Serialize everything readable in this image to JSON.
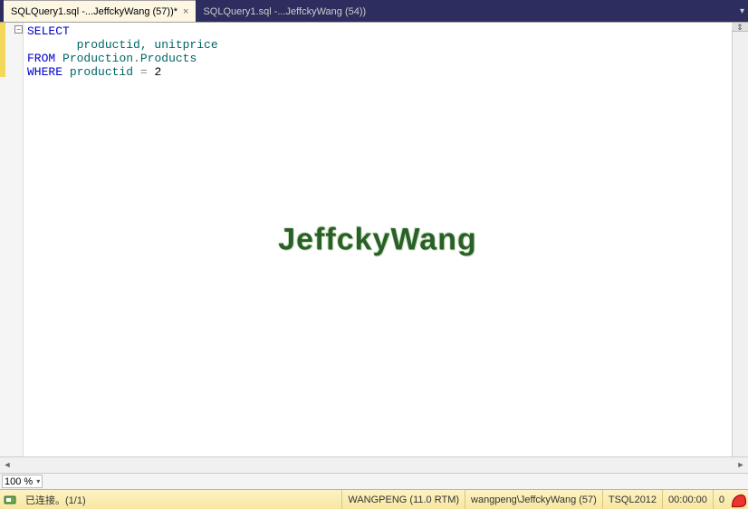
{
  "tabs": [
    {
      "label": "SQLQuery1.sql -...JeffckyWang (57))*",
      "active": true
    },
    {
      "label": "SQLQuery1.sql -...JeffckyWang (54))",
      "active": false
    }
  ],
  "tab_menu_glyph": "▾",
  "code": {
    "line1_kw": "SELECT",
    "line2_indent": "       ",
    "line2_cols": "productid, unitprice",
    "line3_kw": "FROM",
    "line3_tbl_a": "Production",
    "line3_dot": ".",
    "line3_tbl_b": "Products",
    "line4_kw": "WHERE",
    "line4_col": "productid",
    "line4_op": " = ",
    "line4_val": "2"
  },
  "collapse_glyph": "−",
  "watermark": "JeffckyWang",
  "split_glyph": "⇕",
  "zoom": {
    "value": "100 %",
    "chev": "▾"
  },
  "hscroll": {
    "left": "◄",
    "right": "►"
  },
  "status": {
    "connected": "已连接。(1/1)",
    "server": "WANGPENG (11.0 RTM)",
    "user": "wangpeng\\JeffckyWang (57)",
    "db": "TSQL2012",
    "time": "00:00:00",
    "rows": "0"
  }
}
